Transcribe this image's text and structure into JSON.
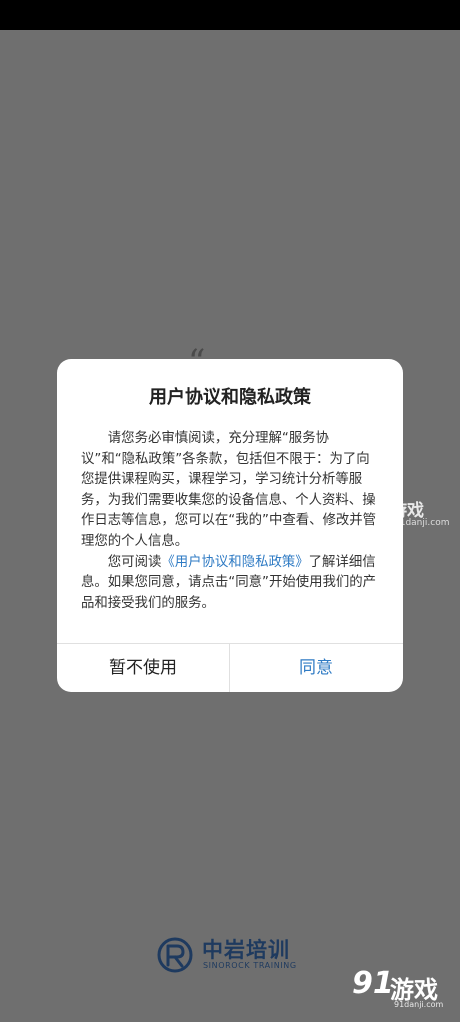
{
  "dialog": {
    "title": "用户协议和隐私政策",
    "para1": "请您务必审慎阅读，充分理解“服务协议”和“隐私政策”各条款，包括但不限于：为了向您提供课程购买，课程学习，学习统计分析等服务，为我们需要收集您的设备信息、个人资料、操作日志等信息，您可以在“我的”中查看、修改并管理您的个人信息。",
    "para2_prefix": "您可阅读",
    "para2_link": "《用户协议和隐私政策》",
    "para2_suffix": "了解详细信息。如果您同意，请点击“同意”开始使用我们的产品和接受我们的服务。",
    "cancel_label": "暂不使用",
    "agree_label": "同意"
  },
  "background": {
    "quote_open": "“",
    "quote_close": "”"
  },
  "logo": {
    "name_cn": "中岩培训",
    "name_en": "SINOROCK TRAINING"
  },
  "watermark": {
    "number": "91",
    "name": "游戏",
    "url": "91danji.com"
  },
  "colors": {
    "overlay": "#6f6f6f",
    "link": "#2f7bc4",
    "logo": "#1e3a5f"
  }
}
